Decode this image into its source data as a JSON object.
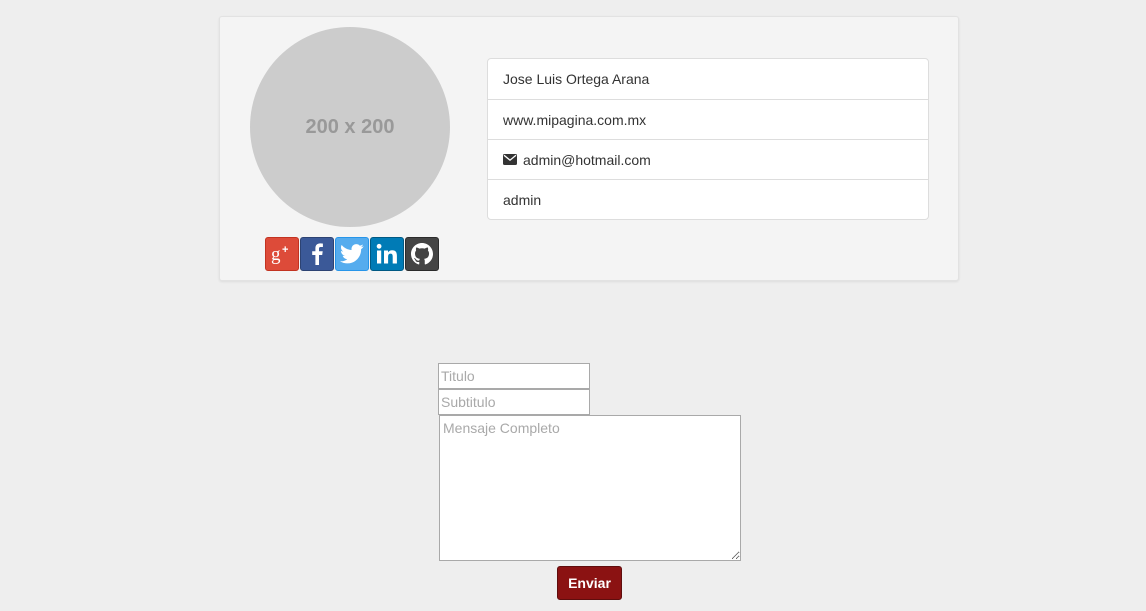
{
  "profile": {
    "avatar_placeholder": "200 x 200",
    "social": [
      {
        "network": "google-plus",
        "icon": "google-plus-icon",
        "color": "#dd4b39"
      },
      {
        "network": "facebook",
        "icon": "facebook-icon",
        "color": "#3b5998"
      },
      {
        "network": "twitter",
        "icon": "twitter-icon",
        "color": "#55acee"
      },
      {
        "network": "linkedin",
        "icon": "linkedin-icon",
        "color": "#007bb6"
      },
      {
        "network": "github",
        "icon": "github-icon",
        "color": "#444444"
      }
    ],
    "info": {
      "name": "Jose Luis Ortega Arana",
      "website": "www.mipagina.com.mx",
      "email": "admin@hotmail.com",
      "email_icon": "envelope-icon",
      "username": "admin"
    }
  },
  "form": {
    "title_placeholder": "Titulo",
    "title_value": "",
    "subtitle_placeholder": "Subtitulo",
    "subtitle_value": "",
    "message_placeholder": "Mensaje Completo",
    "message_value": "",
    "submit_label": "Enviar",
    "submit_color": "#8b1212"
  }
}
